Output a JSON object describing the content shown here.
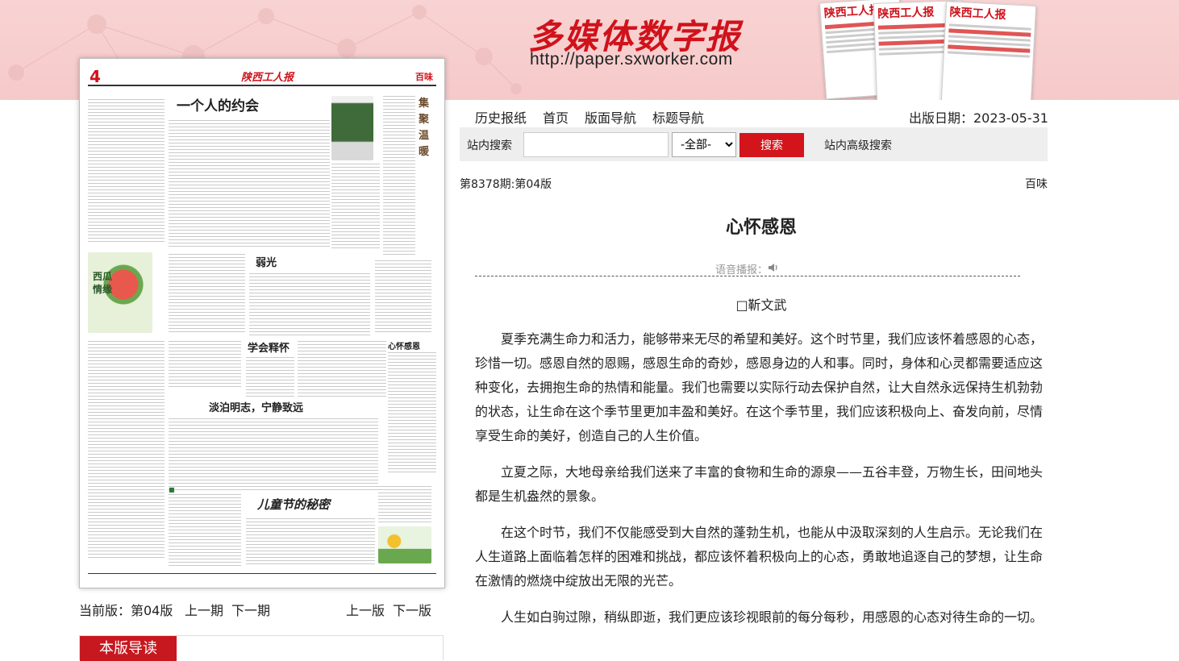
{
  "header": {
    "title": "多媒体数字报",
    "url": "http://paper.sxworker.com",
    "paper_masthead": "陕西工人报",
    "colors": {
      "banner_bg": "#f7cfcf",
      "brand_red": "#d0121b"
    }
  },
  "thumbnail": {
    "page_number": "4",
    "masthead": "陕西工人报",
    "section": "百味",
    "headlines": [
      "一个人的约会",
      "弱光",
      "学会释怀",
      "淡泊明志，宁静致远",
      "儿童节的秘密",
      "心怀感恩"
    ],
    "side_title": "集聚温暖",
    "picture_text": "西瓜情缘"
  },
  "pager": {
    "current_label": "当前版：第04版",
    "prev_issue": "上一期",
    "next_issue": "下一期",
    "prev_page": "上一版",
    "next_page": "下一版"
  },
  "guide": {
    "label": "本版导读"
  },
  "nav": {
    "items": [
      "历史报纸",
      "首页",
      "版面导航",
      "标题导航"
    ],
    "pub_date": "出版日期：2023-05-31"
  },
  "search": {
    "label": "站内搜索",
    "value": "",
    "scope_selected": "-全部-",
    "button": "搜索",
    "advanced": "站内高级搜索"
  },
  "article": {
    "issue": "第8378期:第04版",
    "section": "百味",
    "title": "心怀感恩",
    "tts_label": "语音播报：",
    "author": "□靳文武",
    "paragraphs": [
      "夏季充满生命力和活力，能够带来无尽的希望和美好。这个时节里，我们应该怀着感恩的心态，珍惜一切。感恩自然的恩赐，感恩生命的奇妙，感恩身边的人和事。同时，身体和心灵都需要适应这种变化，去拥抱生命的热情和能量。我们也需要以实际行动去保护自然，让大自然永远保持生机勃勃的状态，让生命在这个季节里更加丰盈和美好。在这个季节里，我们应该积极向上、奋发向前，尽情享受生命的美好，创造自己的人生价值。",
      "立夏之际，大地母亲给我们送来了丰富的食物和生命的源泉——五谷丰登，万物生长，田间地头都是生机盎然的景象。",
      "在这个时节，我们不仅能感受到大自然的蓬勃生机，也能从中汲取深刻的人生启示。无论我们在人生道路上面临着怎样的困难和挑战，都应该怀着积极向上的心态，勇敢地追逐自己的梦想，让生命在激情的燃烧中绽放出无限的光芒。",
      "人生如白驹过隙，稍纵即逝，我们更应该珍视眼前的每分每秒，用感恩的心态对待生命的一切。"
    ]
  }
}
